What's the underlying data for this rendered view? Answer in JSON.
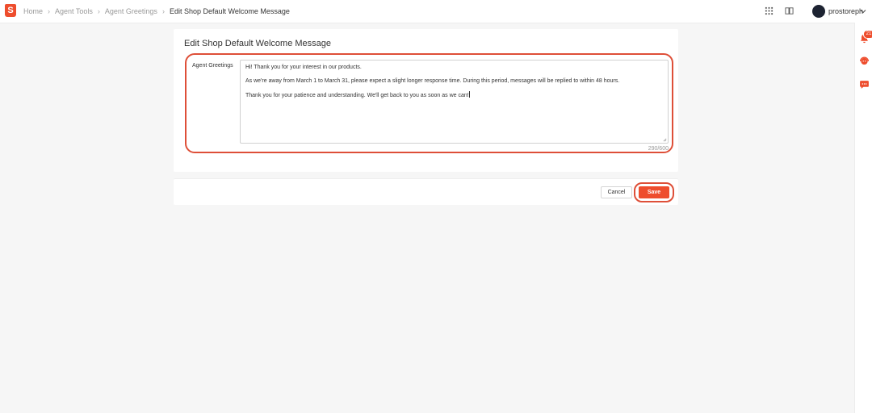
{
  "breadcrumb": {
    "items": [
      "Home",
      "Agent Tools",
      "Agent Greetings"
    ],
    "current": "Edit Shop Default Welcome Message"
  },
  "header": {
    "username": "prostoreph",
    "icons": [
      "apps-grid-icon",
      "book-icon",
      "chevron-down-icon"
    ]
  },
  "right_rail": {
    "notification_count": "21",
    "icons": [
      "bell-icon",
      "support-agent-icon",
      "chat-icon"
    ]
  },
  "page": {
    "title": "Edit Shop Default Welcome Message",
    "field_label": "Agent Greetings",
    "message_lines": [
      "Hi! Thank you for your interest in our products.",
      "As we're away from March 1 to March 31, please expect a slight longer response time. During this period, messages will be replied to within 48 hours.",
      "Thank you for your patience and understanding. We'll get back to you as soon as we can!"
    ],
    "char_count": "290/600"
  },
  "actions": {
    "cancel_label": "Cancel",
    "save_label": "Save"
  },
  "colors": {
    "brand": "#ee4d2d",
    "highlight": "#de4f38"
  }
}
